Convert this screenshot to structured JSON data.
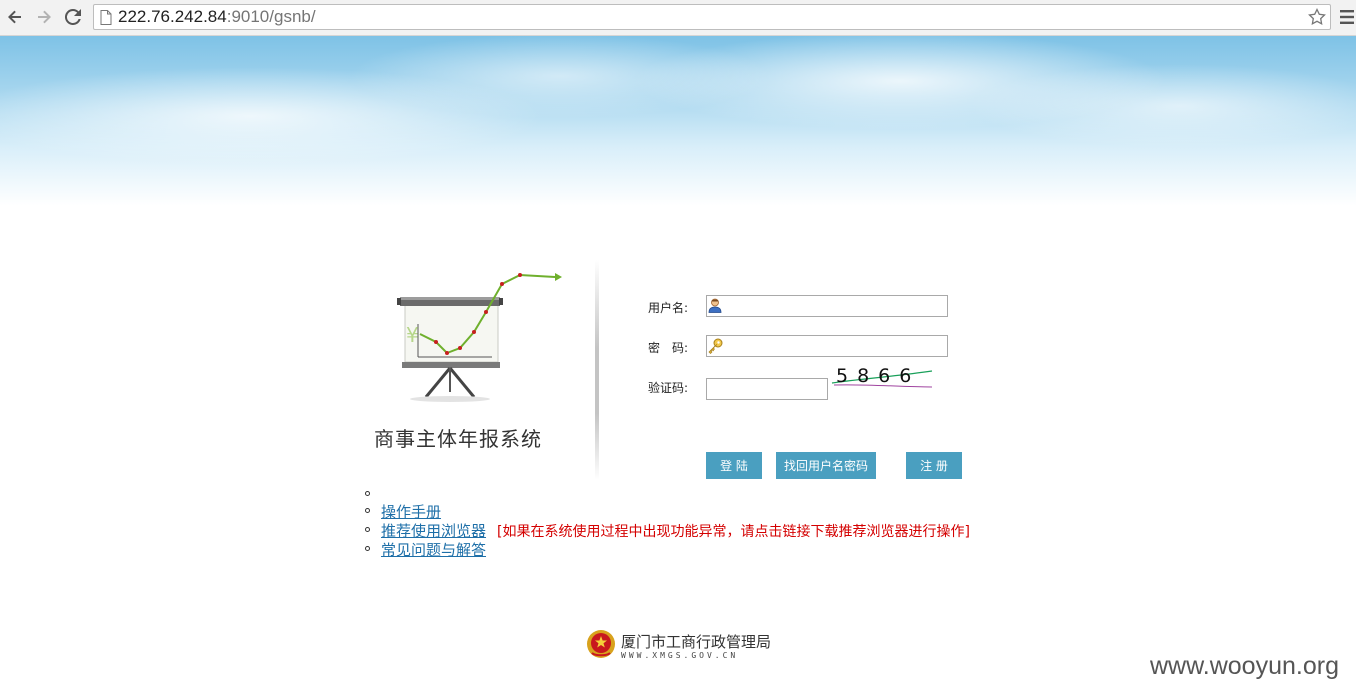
{
  "browser": {
    "url_host": "222.76.242.84",
    "url_rest": ":9010/gsnb/"
  },
  "system": {
    "title": "商事主体年报系统"
  },
  "form": {
    "username_label": "用户名:",
    "password_label": "密　码:",
    "captcha_label": "验证码:",
    "captcha_code": "5866",
    "login_button": "登 陆",
    "recover_button": "找回用户名密码",
    "register_button": "注 册"
  },
  "links": {
    "manual": "操作手册",
    "browser": "推荐使用浏览器",
    "browser_note": "[如果在系统使用过程中出现功能异常，请点击链接下载推荐浏览器进行操作]",
    "faq": "常见问题与解答"
  },
  "footer": {
    "org_name": "厦门市工商行政管理局",
    "org_url": "WWW.XMGS.GOV.CN"
  },
  "watermark": "www.wooyun.org",
  "colors": {
    "button_bg": "#4a9fc0",
    "link": "#1e6fa8",
    "warning": "#d40000"
  }
}
